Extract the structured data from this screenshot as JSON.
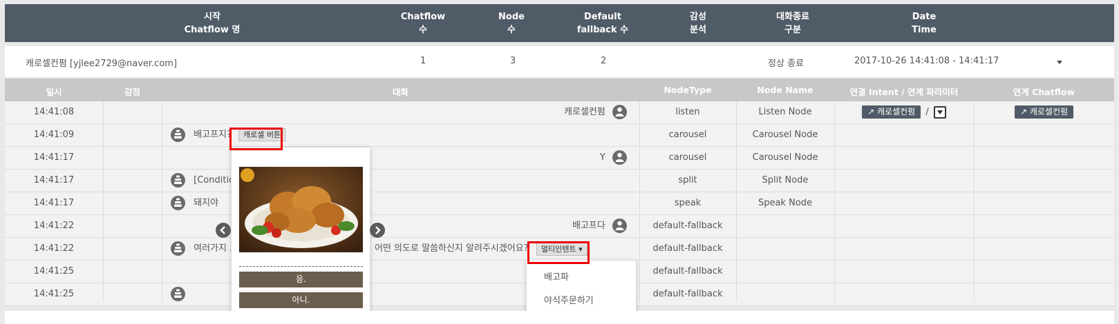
{
  "header": {
    "col_start_chatflow": "시작\nChatflow 명",
    "col_chatflow_count": "Chatflow\n수",
    "col_node_count": "Node\n수",
    "col_default_fallback": "Default\nfallback 수",
    "col_sentiment": "감성\n분석",
    "col_end_type": "대화종료\n구분",
    "col_datetime": "Date\nTime"
  },
  "summary": {
    "chatflow_name": "캐로셀컨펌 [yjlee2729@naver.com]",
    "chatflow_count": "1",
    "node_count": "3",
    "fallback_count": "2",
    "end_type": "정상 종료",
    "datetime": "2017-10-26 14:41:08 - 14:41:17"
  },
  "detail_header": {
    "time": "일시",
    "sentiment": "감정",
    "conversation": "대화",
    "node_type": "NodeType",
    "node_name": "Node Name",
    "intent": "연결 Intent / 연계 파라미터",
    "linked_chatflow": "연계 Chatflow"
  },
  "rows": [
    {
      "time": "14:41:08",
      "user_text": "캐로셀컨펌",
      "node_type": "listen",
      "node_name": "Listen Node",
      "intent_btn": "캐로셀컨펌",
      "intent_sep": "/",
      "linked_btn": "캐로셀컨펌"
    },
    {
      "time": "14:41:09",
      "bot_text": "배고프지?",
      "bot_pill": "캐로셀 버튼",
      "node_type": "carousel",
      "node_name": "Carousel Node"
    },
    {
      "time": "14:41:17",
      "user_text": "Y",
      "node_type": "carousel",
      "node_name": "Carousel Node"
    },
    {
      "time": "14:41:17",
      "bot_text": "[Condition",
      "node_type": "split",
      "node_name": "Split Node"
    },
    {
      "time": "14:41:17",
      "bot_text": "돼지야",
      "node_type": "speak",
      "node_name": "Speak Node"
    },
    {
      "time": "14:41:22",
      "user_text": "배고프다",
      "node_type": "default-fallback",
      "node_name": ""
    },
    {
      "time": "14:41:22",
      "bot_text": "여러가지 으",
      "bot_text_tail": "어떤 의도로 말씀하신지 알려주시겠어요?",
      "bot_pill": "멀티인텐트",
      "node_type": "default-fallback",
      "node_name": ""
    },
    {
      "time": "14:41:25",
      "node_type": "default-fallback",
      "node_name": ""
    },
    {
      "time": "14:41:25",
      "node_type": "default-fallback",
      "node_name": ""
    }
  ],
  "carousel": {
    "btn_yes": "응.",
    "btn_no": "아니."
  },
  "multi_intent_menu": [
    "배고파",
    "야식주문하기"
  ],
  "colors": {
    "header_bg": "#4f5b66",
    "detail_header_bg": "#c8c8c8",
    "row_bg": "#f2f2f2",
    "highlight": "#ee0000",
    "carousel_btn": "#6b5e4e"
  }
}
